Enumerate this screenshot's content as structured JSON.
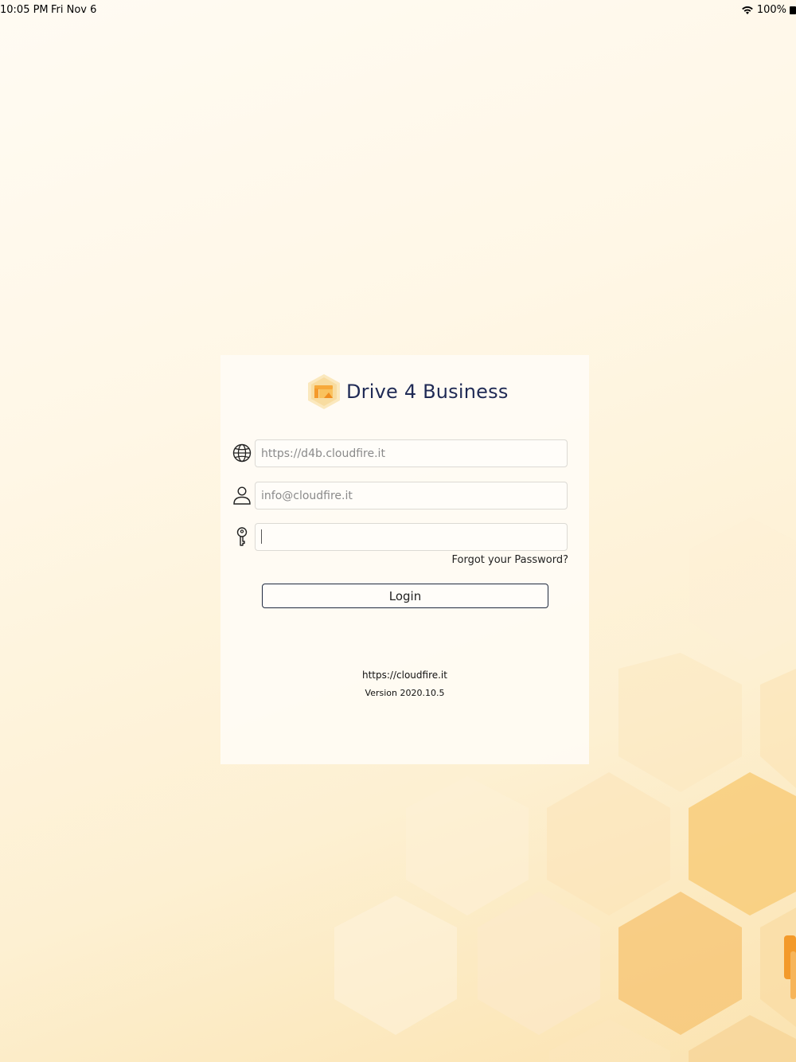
{
  "status_bar": {
    "time": "10:05 PM",
    "date": "Fri Nov 6",
    "battery": "100%"
  },
  "brand": {
    "title": "Drive 4 Business",
    "logo_icon": "hexagon-folder-logo-icon"
  },
  "form": {
    "server_field": {
      "icon": "globe-icon",
      "placeholder": "https://d4b.cloudfire.it",
      "value": ""
    },
    "user_field": {
      "icon": "user-icon",
      "placeholder": "info@cloudfire.it",
      "value": ""
    },
    "password_field": {
      "icon": "key-icon",
      "placeholder": "",
      "value": ""
    },
    "forgot_label": "Forgot your Password?",
    "login_label": "Login"
  },
  "footer": {
    "link": "https://cloudfire.it",
    "version": "Version 2020.10.5"
  },
  "colors": {
    "brand_text": "#1f2a55",
    "accent_orange": "#f5b43c",
    "background": "#fff7e6"
  }
}
